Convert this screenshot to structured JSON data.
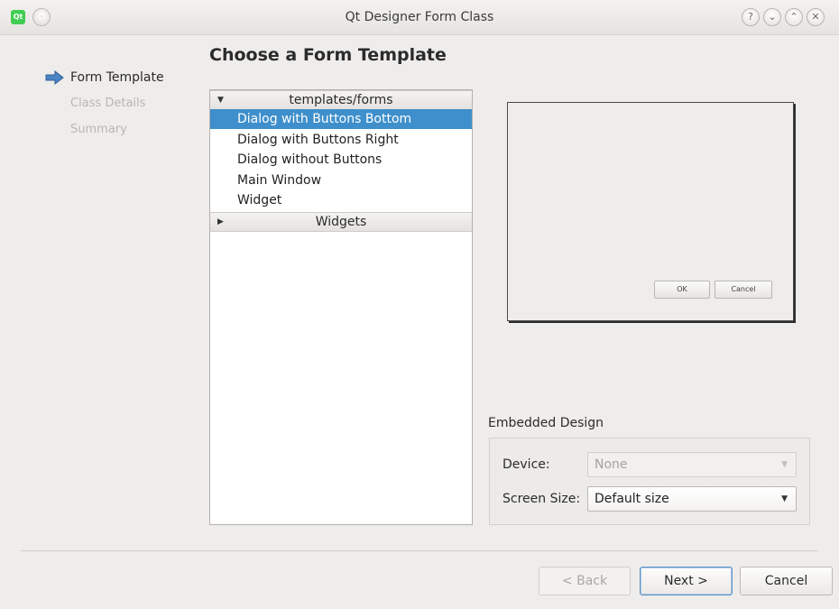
{
  "window": {
    "title": "Qt Designer Form Class",
    "app_icon": "Qt",
    "icons": {
      "menu": "menu-circle-icon",
      "help": "help-icon",
      "minimize": "minimize-icon",
      "maximize": "maximize-icon",
      "close": "close-icon"
    },
    "help_glyph": "?",
    "minimize_glyph": "⌄",
    "maximize_glyph": "⌃",
    "close_glyph": "✕"
  },
  "wizard_nav": {
    "steps": [
      {
        "label": "Form Template",
        "active": true
      },
      {
        "label": "Class Details",
        "active": false
      },
      {
        "label": "Summary",
        "active": false
      }
    ]
  },
  "page": {
    "heading": "Choose a Form Template"
  },
  "template_tree": {
    "categories": [
      {
        "label": "templates/forms",
        "expanded": true,
        "items": [
          "Dialog with Buttons Bottom",
          "Dialog with Buttons Right",
          "Dialog without Buttons",
          "Main Window",
          "Widget"
        ],
        "selected_item": "Dialog with Buttons Bottom"
      },
      {
        "label": "Widgets",
        "expanded": false
      }
    ]
  },
  "preview": {
    "ok_label": "OK",
    "cancel_label": "Cancel"
  },
  "embedded_design": {
    "label": "Embedded Design",
    "device_label": "Device:",
    "device_value": "None",
    "screen_size_label": "Screen Size:",
    "screen_size_value": "Default size"
  },
  "buttons": {
    "back": "< Back",
    "next": "Next >",
    "cancel": "Cancel"
  },
  "colors": {
    "selection": "#3e8fcb",
    "window_bg": "#efedeb",
    "nav_arrow": "#4a84c4"
  }
}
